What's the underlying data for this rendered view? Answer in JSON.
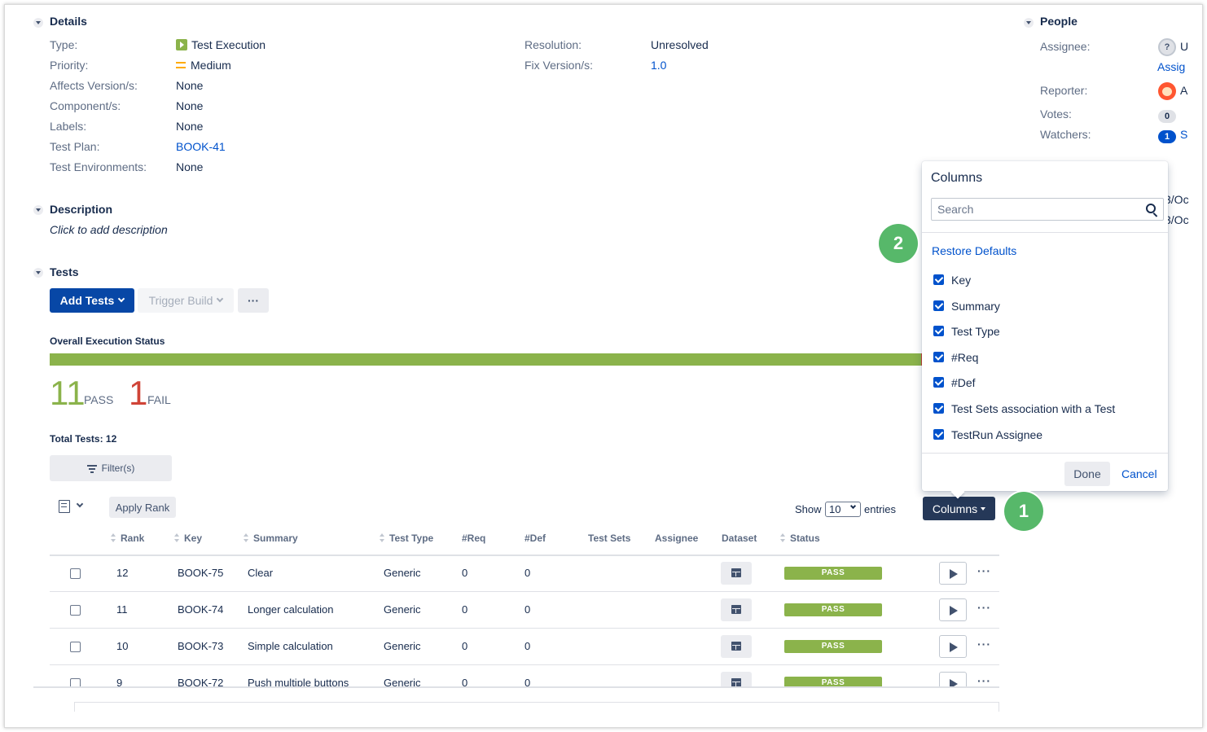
{
  "details": {
    "section_title": "Details",
    "fields_left": [
      {
        "label": "Type:",
        "value": "Test Execution"
      },
      {
        "label": "Priority:",
        "value": "Medium"
      },
      {
        "label": "Affects Version/s:",
        "value": "None"
      },
      {
        "label": "Component/s:",
        "value": "None"
      },
      {
        "label": "Labels:",
        "value": "None"
      },
      {
        "label": "Test Plan:",
        "value": "BOOK-41"
      },
      {
        "label": "Test Environments:",
        "value": "None"
      }
    ],
    "fields_right": [
      {
        "label": "Resolution:",
        "value": "Unresolved"
      },
      {
        "label": "Fix Version/s:",
        "value": "1.0"
      }
    ]
  },
  "people": {
    "section_title": "People",
    "assignee_label": "Assignee:",
    "assignee_value": "U",
    "assign_link": "Assig",
    "reporter_label": "Reporter:",
    "reporter_value": "A",
    "votes_label": "Votes:",
    "votes_count": "0",
    "watchers_label": "Watchers:",
    "watchers_count": "1",
    "watchers_suffix": "S",
    "partial_1": "3/Oc",
    "partial_2": "3/Oc"
  },
  "description": {
    "section_title": "Description",
    "placeholder": "Click to add description"
  },
  "tests": {
    "section_title": "Tests",
    "add_tests_label": "Add Tests",
    "trigger_build_label": "Trigger Build",
    "more_label": "···",
    "overall_status_label": "Overall Execution Status",
    "pass_count": "11",
    "pass_label": "PASS",
    "fail_count": "1",
    "fail_label": "FAIL",
    "fail_fraction": 0.0833,
    "total_tests_label": "Total Tests: 12",
    "filter_label": "Filter(s)",
    "apply_rank_label": "Apply Rank",
    "show_label": "Show",
    "show_value": "10",
    "entries_label": "entries",
    "columns_button_label": "Columns",
    "headers": [
      "Rank",
      "Key",
      "Summary",
      "Test Type",
      "#Req",
      "#Def",
      "Test Sets",
      "Assignee",
      "Dataset",
      "Status"
    ],
    "rows": [
      {
        "rank": "12",
        "key": "BOOK-75",
        "summary": "Clear",
        "test_type": "Generic",
        "req": "0",
        "def": "0",
        "status": "PASS"
      },
      {
        "rank": "11",
        "key": "BOOK-74",
        "summary": "Longer calculation",
        "test_type": "Generic",
        "req": "0",
        "def": "0",
        "status": "PASS"
      },
      {
        "rank": "10",
        "key": "BOOK-73",
        "summary": "Simple calculation",
        "test_type": "Generic",
        "req": "0",
        "def": "0",
        "status": "PASS"
      },
      {
        "rank": "9",
        "key": "BOOK-72",
        "summary": "Push multiple buttons",
        "test_type": "Generic",
        "req": "0",
        "def": "0",
        "status": "PASS"
      }
    ]
  },
  "columns_dropdown": {
    "title": "Columns",
    "search_placeholder": "Search",
    "restore_defaults": "Restore Defaults",
    "options": [
      "Key",
      "Summary",
      "Test Type",
      "#Req",
      "#Def",
      "Test Sets association with a Test",
      "TestRun Assignee"
    ],
    "done_label": "Done",
    "cancel_label": "Cancel"
  },
  "steps": {
    "step1": "1",
    "step2": "2"
  },
  "colors": {
    "pass": "#8bb34b",
    "fail": "#d04437",
    "primary": "#0747a6",
    "link": "#0052cc",
    "step": "#57b86a"
  }
}
